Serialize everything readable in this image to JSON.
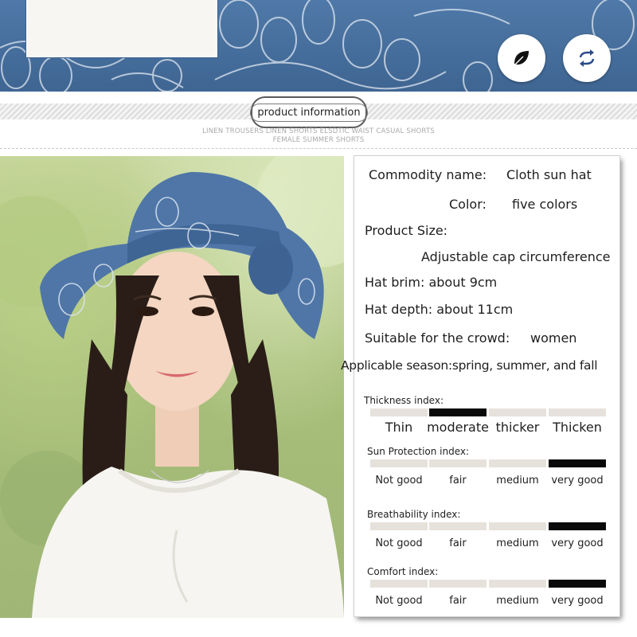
{
  "colors": {
    "denim": "#4f79a8",
    "bar_inactive": "#e6e2db",
    "bar_active": "#0a0a0a"
  },
  "banner": {
    "icons": [
      "leaf-icon",
      "swap-arrows-icon"
    ]
  },
  "header": {
    "badge_label": "product information",
    "caption_line1": "LINEN TROUSERS LINEN SHORTS ELSDTIC WAIST CASUAL SHORTS",
    "caption_line2": "FEMALE SUMMER SHORTS"
  },
  "specs": {
    "commodity_label": "Commodity name:",
    "commodity_value": "Cloth sun hat",
    "color_label": "Color:",
    "color_value": "five colors",
    "size_label": "Product Size:",
    "size_value": "Adjustable cap circumference",
    "brim": "Hat brim: about 9cm",
    "depth": "Hat depth: about 11cm",
    "crowd_label": "Suitable for the crowd:",
    "crowd_value": "women",
    "season": "Applicable season:spring, summer, and fall"
  },
  "indices": [
    {
      "title": "Thickness index:",
      "levels": [
        "Thin",
        "moderate",
        "thicker",
        "Thicken"
      ],
      "selected": 1
    },
    {
      "title": "Sun Protection index:",
      "levels": [
        "Not good",
        "fair",
        "medium",
        "very good"
      ],
      "selected": 3
    },
    {
      "title": "Breathability index:",
      "levels": [
        "Not good",
        "fair",
        "medium",
        "very good"
      ],
      "selected": 3
    },
    {
      "title": "Comfort index:",
      "levels": [
        "Not good",
        "fair",
        "medium",
        "very good"
      ],
      "selected": 3
    }
  ]
}
